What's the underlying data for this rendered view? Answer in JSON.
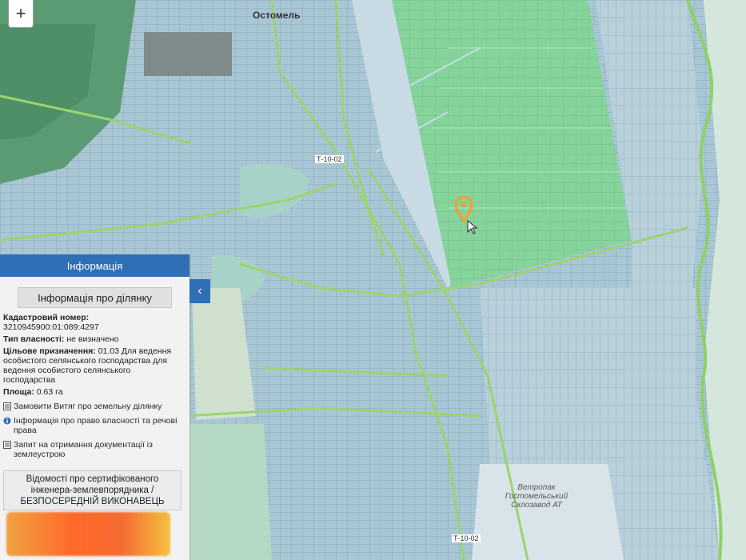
{
  "map": {
    "labels": {
      "town": "Остомель",
      "road_code_1": "Т-10-02",
      "road_code_2": "Т-10-02",
      "factory": "Ветропак Гостомельський Склозавод АТ"
    },
    "marker_icon": "map-pin-icon",
    "colors": {
      "parcel_fill": "#a9c8d8",
      "road": "#8fd06a",
      "green_area": "#7fcf96",
      "marker": "#f0a030"
    }
  },
  "controls": {
    "zoom_in": "+",
    "collapse": "‹"
  },
  "panel": {
    "header": "Інформація",
    "section_title": "Інформація про ділянку",
    "cadastral_label": "Кадастровий номер:",
    "cadastral_value": "3210945900:01:089:4297",
    "ownership_label": "Тип власності:",
    "ownership_value": "не визначено",
    "purpose_label": "Цільове призначення:",
    "purpose_value": "01.03 Для ведення особистого селянського господарства для ведення особистого селянського господарства",
    "area_label": "Площа:",
    "area_value": "0.63 га",
    "link_extract": "Замовити Витяг про земельну ділянку",
    "link_rights": "Інформація про право власності та речові права",
    "link_docs": "Запит на отримання документації із землеустрою",
    "engineer_text": "Відомості про сертифікованого інженера-землевпорядника / БЕЗПОСЕРЕДНІЙ ВИКОНАВЕЦЬ"
  }
}
